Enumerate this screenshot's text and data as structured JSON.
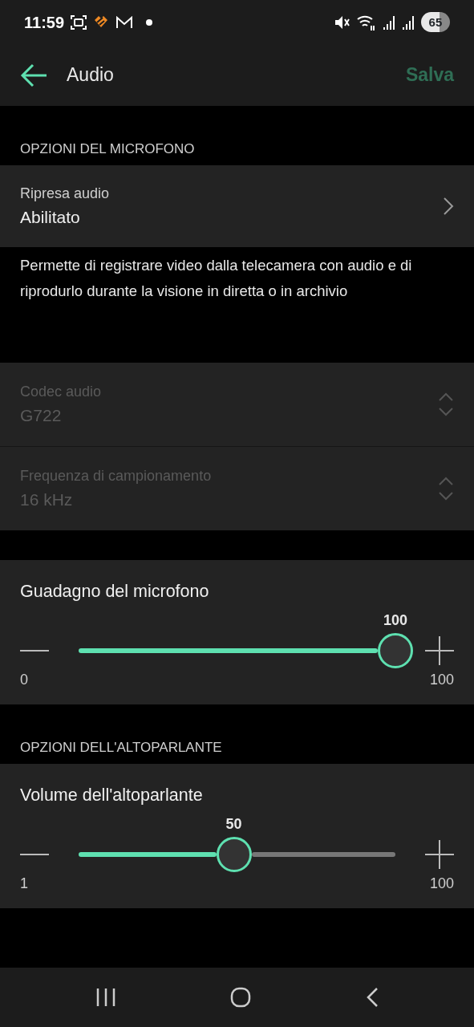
{
  "status_bar": {
    "time": "11:59",
    "battery": "65"
  },
  "header": {
    "title": "Audio",
    "save": {
      "label": "Salva",
      "disabled": true
    }
  },
  "sections": [
    {
      "kind": "nav",
      "heading": "OPZIONI DEL MICROFONO",
      "label": "Ripresa audio",
      "value": "Abilitato",
      "note": "Permette di registrare video dalla telecamera con audio e di riprodurlo durante la visione in diretta o in archivio"
    },
    {
      "kind": "selects",
      "items": [
        {
          "label": "Codec audio",
          "value": "G722",
          "disabled": true
        },
        {
          "label": "Frequenza di campionamento",
          "value": "16 kHz",
          "disabled": true
        }
      ]
    },
    {
      "kind": "slider",
      "title": "Guadagno del microfono",
      "reading": "100",
      "min": "0",
      "max": "100",
      "level": 1
    },
    {
      "kind": "slider",
      "heading": "OPZIONI DELL'ALTOPARLANTE",
      "title": "Volume dell'altoparlante",
      "reading": "50",
      "min": "1",
      "max": "100",
      "level": 0.49
    }
  ]
}
